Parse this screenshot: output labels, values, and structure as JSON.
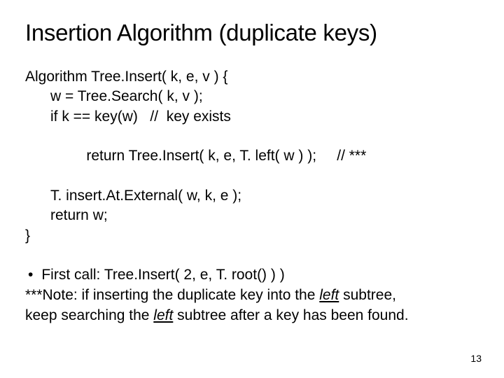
{
  "title": "Insertion Algorithm (duplicate keys)",
  "code": {
    "l1": "Algorithm Tree.Insert( k, e, v ) {",
    "l2": "w = Tree.Search( k, v );",
    "l3": "if k == key(w)   //  key exists",
    "l4a": "return Tree.Insert( k, e, T. left( w ) );",
    "l4b": "// ***",
    "l5": "T. insert.At.External( w, k, e );",
    "l6": "return w;",
    "l7": "}"
  },
  "bullet": "•",
  "note1": "First call: Tree.Insert( 2, e, T. root() ) )",
  "note2a": "***Note: if inserting the duplicate key into the ",
  "note2u": "left",
  "note2b": " subtree,",
  "note3a": "keep searching the ",
  "note3u": "left",
  "note3b": " subtree after a key has been found.",
  "pagenum": "13"
}
